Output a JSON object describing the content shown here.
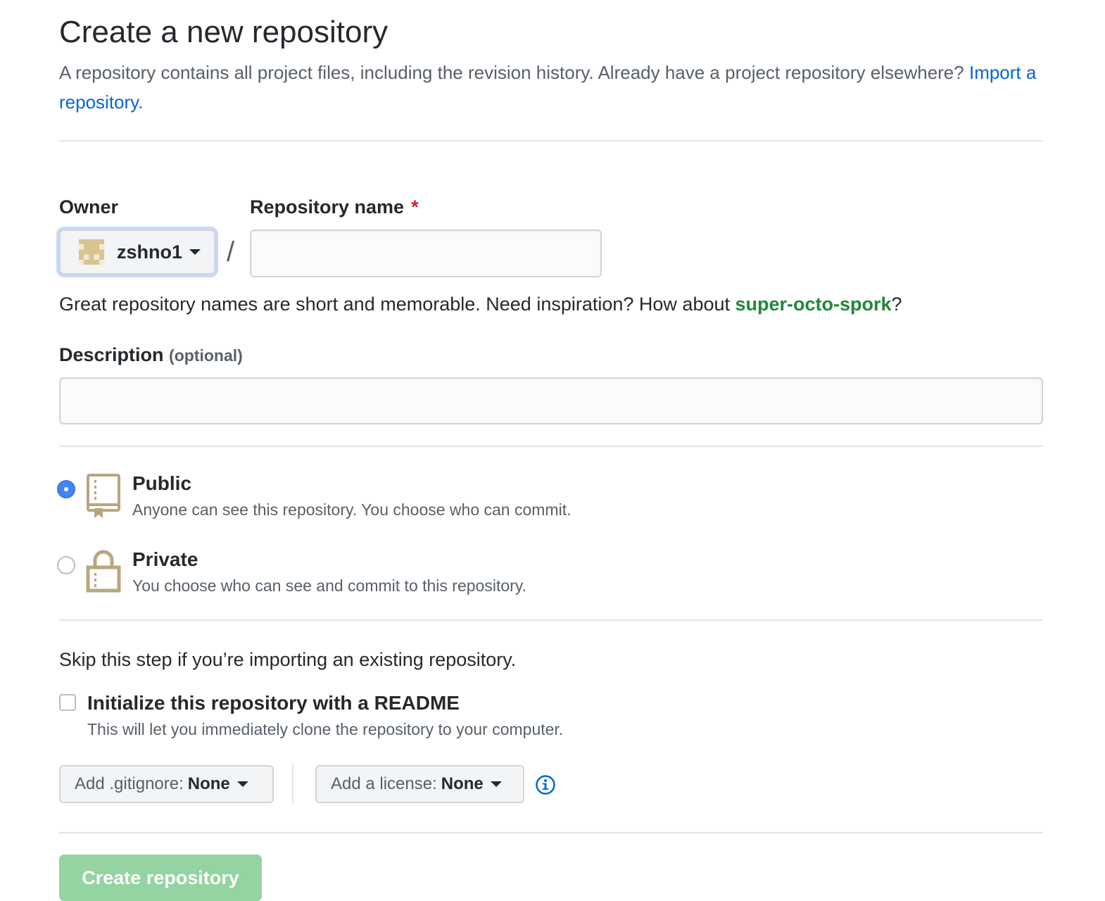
{
  "header": {
    "title": "Create a new repository",
    "subtitle": "A repository contains all project files, including the revision history. Already have a project repository elsewhere?",
    "import_link": "Import a repository."
  },
  "owner": {
    "label": "Owner",
    "value": "zshno1",
    "avatar_icon": "identicon-avatar"
  },
  "separator": "/",
  "repo_name": {
    "label": "Repository name",
    "required_mark": "*",
    "value": "",
    "placeholder": ""
  },
  "name_hint": {
    "text": "Great repository names are short and memorable. Need inspiration? How about",
    "suggestion": "super-octo-spork",
    "suffix": "?"
  },
  "description": {
    "label": "Description",
    "optional": "(optional)",
    "value": "",
    "placeholder": ""
  },
  "visibility": {
    "selected": "public",
    "options": [
      {
        "id": "public",
        "title": "Public",
        "description": "Anyone can see this repository. You choose who can commit.",
        "icon": "repo-icon"
      },
      {
        "id": "private",
        "title": "Private",
        "description": "You choose who can see and commit to this repository.",
        "icon": "lock-icon"
      }
    ]
  },
  "init": {
    "skip_text": "Skip this step if you’re importing an existing repository.",
    "readme_title": "Initialize this repository with a README",
    "readme_desc": "This will let you immediately clone the repository to your computer.",
    "readme_checked": false
  },
  "gitignore": {
    "prefix": "Add .gitignore:",
    "value": "None"
  },
  "license": {
    "prefix": "Add a license:",
    "value": "None"
  },
  "info_icon": "info-icon",
  "submit": {
    "label": "Create repository",
    "enabled": false
  },
  "colors": {
    "link": "#0366d6",
    "suggestion": "#22863a",
    "required": "#cb2431",
    "radio_checked": "#4285f4",
    "submit_disabled": "#94d3a2",
    "icon_tan": "#b9a67d"
  }
}
